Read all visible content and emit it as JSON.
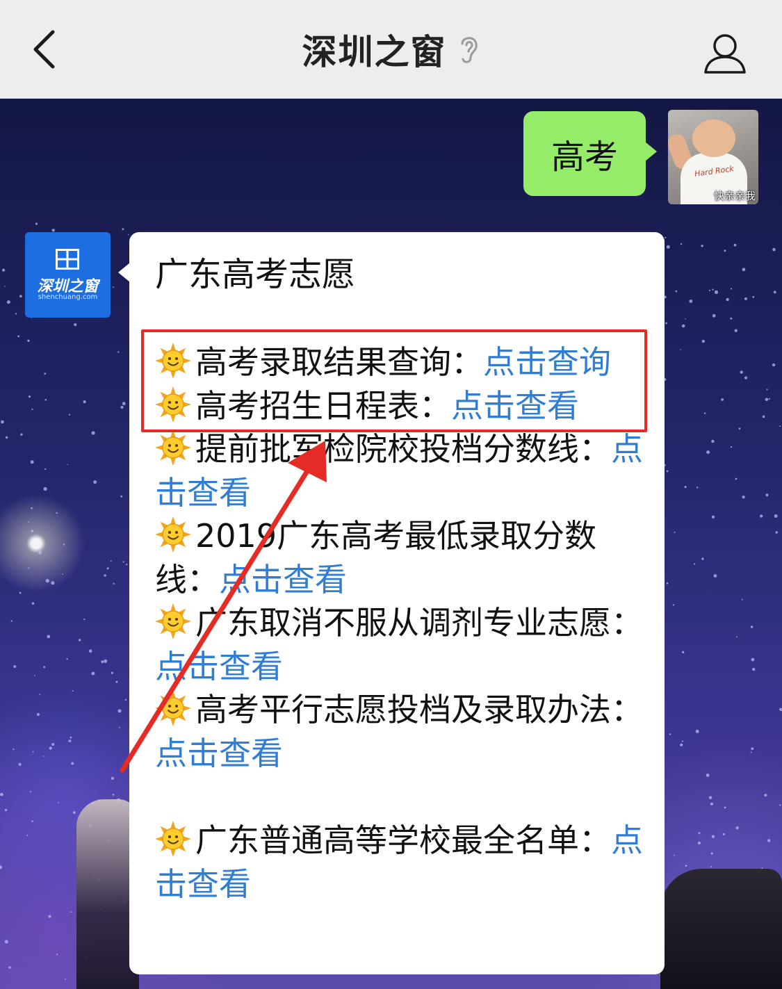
{
  "header": {
    "title": "深圳之窗",
    "back_icon": "chevron-left-icon",
    "right_icon": "profile-icon",
    "ear_icon": "ear-icon"
  },
  "outgoing_message": {
    "text": "高考",
    "bubble_color": "#95ec69",
    "avatar_caption": "快亲亲我",
    "avatar_shirt_text": "Hard Rock"
  },
  "incoming_message": {
    "sender_logo_text": "深圳之窗",
    "sender_logo_sub": "shenchuang.com",
    "title": "广东高考志愿",
    "items": [
      {
        "text": "高考录取结果查询：",
        "link": "点击查询"
      },
      {
        "text": "高考招生日程表：",
        "link": "点击查看"
      },
      {
        "text": "提前批军检院校投档分数线：",
        "link": "点击查看"
      },
      {
        "text": "2019广东高考最低录取分数线：",
        "link": "点击查看"
      },
      {
        "text": "广东取消不服从调剂专业志愿：",
        "link": "点击查看"
      },
      {
        "text": "高考平行志愿投档及录取办法：",
        "link": "点击查看"
      }
    ],
    "last_item": {
      "text": "广东普通高等学校最全名单：",
      "link": "点击查看"
    },
    "link_color": "#2f7ed4",
    "item_icon": "sun-emoji-icon"
  },
  "annotation": {
    "highlight_color": "#e52b25"
  }
}
